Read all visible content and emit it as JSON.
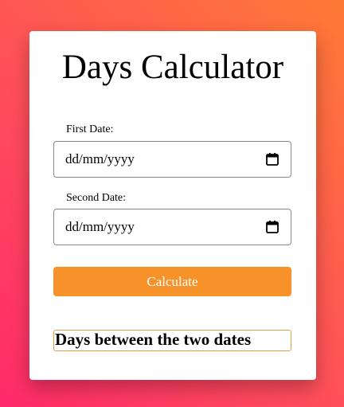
{
  "app": {
    "title": "Days Calculator"
  },
  "form": {
    "first_date": {
      "label": "First Date:",
      "value_display": "dd/mm/yyyy",
      "icon": "calendar-icon"
    },
    "second_date": {
      "label": "Second Date:",
      "value_display": "dd/mm/yyyy",
      "icon": "calendar-icon"
    },
    "calculate_label": "Calculate"
  },
  "result": {
    "text": "Days between the two dates"
  },
  "colors": {
    "button": "#f7922a",
    "background_start": "#ff2a6a",
    "background_end": "#ff7a35",
    "result_border": "#e0a04a"
  }
}
